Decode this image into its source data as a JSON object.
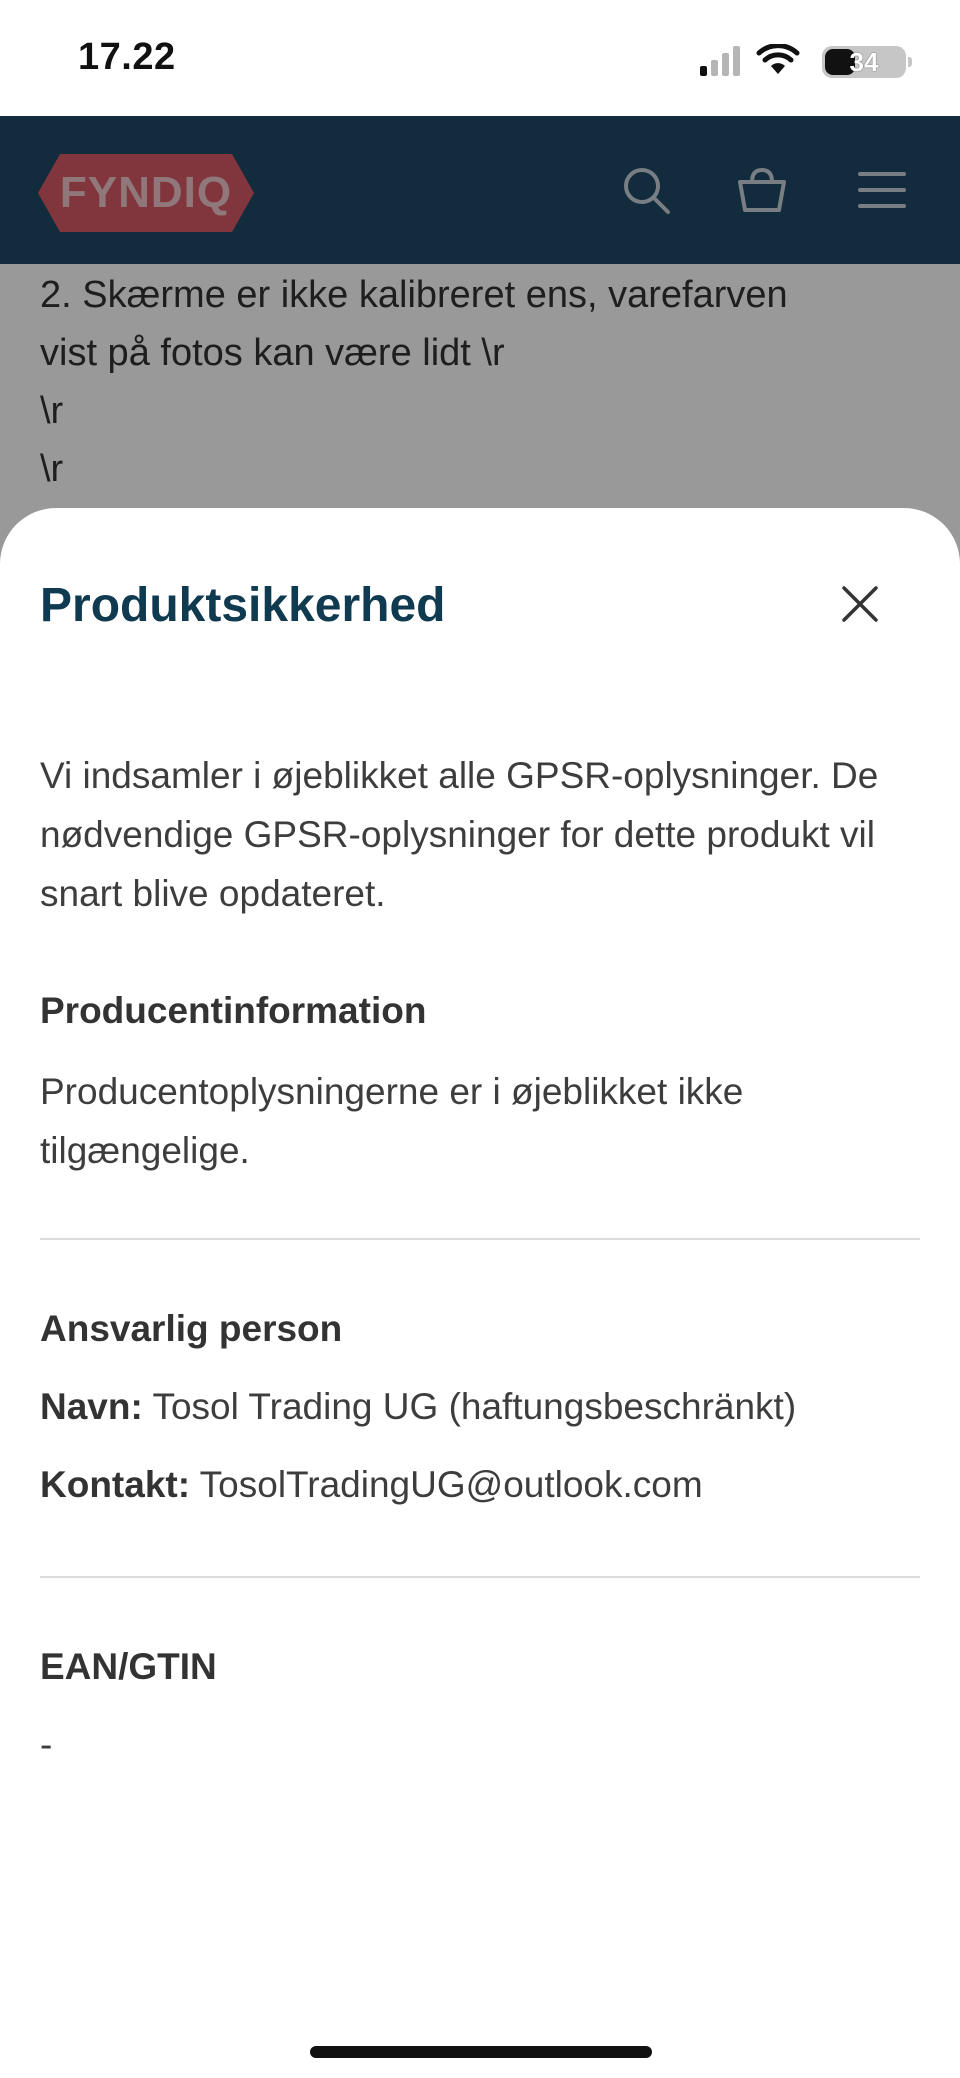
{
  "status_bar": {
    "time": "17.22",
    "battery": "34",
    "icons": [
      "cellular-signal-icon",
      "wifi-icon",
      "battery-icon"
    ]
  },
  "header": {
    "logo_text": "FYNDIQ",
    "icons": [
      "search-icon",
      "cart-icon",
      "menu-icon"
    ],
    "colors": {
      "background": "#1e4a66",
      "logo": "#d85a68"
    }
  },
  "background_page": {
    "lines": [
      "2. Skærme er ikke kalibreret ens, varefarven",
      "vist på fotos kan være lidt \\r",
      "\\r",
      "\\r"
    ]
  },
  "sheet": {
    "title": "Produktsikkerhed",
    "intro": "Vi indsamler i øjeblikket alle GPSR-oplysninger. De nødvendige GPSR-oplysninger for dette produkt vil snart blive opdateret.",
    "manufacturer": {
      "heading": "Producentinformation",
      "text": "Producentoplysningerne er i øjeblikket ikke tilgængelige."
    },
    "responsible_person": {
      "heading": "Ansvarlig person",
      "name_label": "Navn:",
      "name_value": "Tosol Trading UG (haftungsbeschränkt)",
      "contact_label": "Kontakt:",
      "contact_value": "TosolTradingUG@outlook.com"
    },
    "ean": {
      "heading": "EAN/GTIN",
      "value": "-"
    },
    "title_color": "#0f3a4f"
  }
}
